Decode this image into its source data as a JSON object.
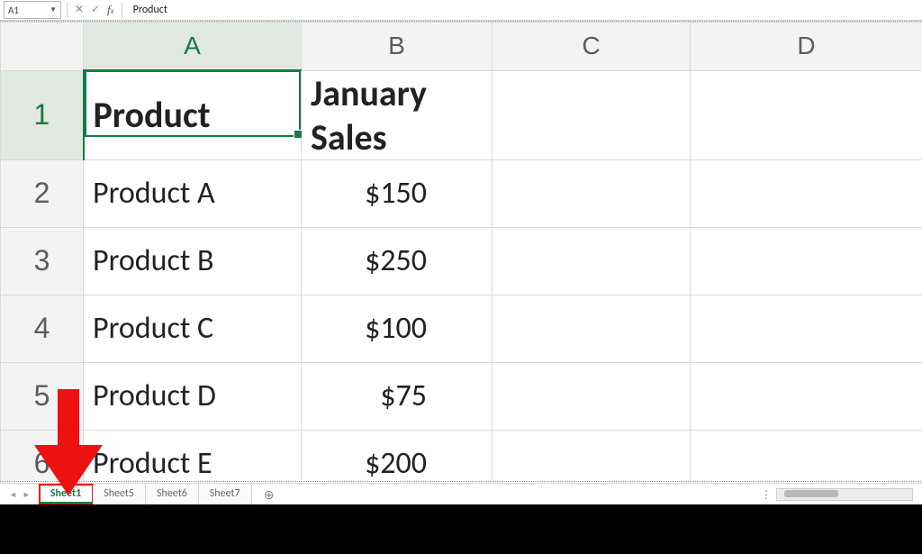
{
  "formula_bar": {
    "cell_ref": "A1",
    "content": "Product"
  },
  "columns": [
    "A",
    "B",
    "C",
    "D"
  ],
  "rows": [
    "1",
    "2",
    "3",
    "4",
    "5",
    "6"
  ],
  "selected_cell": "A1",
  "cells": {
    "r1": {
      "A": "Product",
      "B": "January Sales",
      "C": "",
      "D": ""
    },
    "r2": {
      "A": "Product A",
      "B": "$150",
      "C": "",
      "D": ""
    },
    "r3": {
      "A": "Product B",
      "B": "$250",
      "C": "",
      "D": ""
    },
    "r4": {
      "A": "Product C",
      "B": "$100",
      "C": "",
      "D": ""
    },
    "r5": {
      "A": "Product D",
      "B": "$75",
      "C": "",
      "D": ""
    },
    "r6": {
      "A": "Product E",
      "B": "$200",
      "C": "",
      "D": ""
    }
  },
  "tabs": {
    "items": [
      "Sheet1",
      "Sheet5",
      "Sheet6",
      "Sheet7"
    ],
    "active_index": 0,
    "highlighted_index": 0
  }
}
